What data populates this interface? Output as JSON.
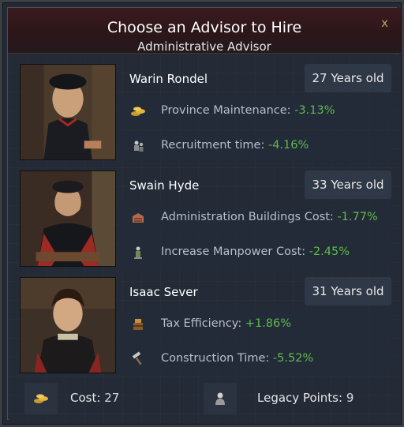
{
  "dialog": {
    "title": "Choose an Advisor to Hire",
    "subtitle": "Administrative Advisor",
    "close_label": "x"
  },
  "advisors": [
    {
      "name": "Warin Rondel",
      "age": "27 Years old",
      "modifiers": [
        {
          "icon": "coins-icon",
          "label": "Province Maintenance:",
          "value": "-3.13%"
        },
        {
          "icon": "soldiers-icon",
          "label": "Recruitment time:",
          "value": "-4.16%"
        }
      ]
    },
    {
      "name": "Swain Hyde",
      "age": "33 Years old",
      "modifiers": [
        {
          "icon": "building-icon",
          "label": "Administration Buildings Cost:",
          "value": "-1.77%"
        },
        {
          "icon": "manpower-icon",
          "label": "Increase Manpower Cost:",
          "value": "-2.45%"
        }
      ]
    },
    {
      "name": "Isaac Sever",
      "age": "31 Years old",
      "modifiers": [
        {
          "icon": "tax-icon",
          "label": "Tax Efficiency:",
          "value": "+1.86%"
        },
        {
          "icon": "hammer-icon",
          "label": "Construction Time:",
          "value": "-5.52%"
        }
      ]
    }
  ],
  "footer": {
    "cost_label": "Cost:",
    "cost_value": "27",
    "legacy_label": "Legacy Points:",
    "legacy_value": "9"
  },
  "colors": {
    "positive": "#5dbb4b",
    "header": "#3a1a1e",
    "panel": "#242b37"
  }
}
